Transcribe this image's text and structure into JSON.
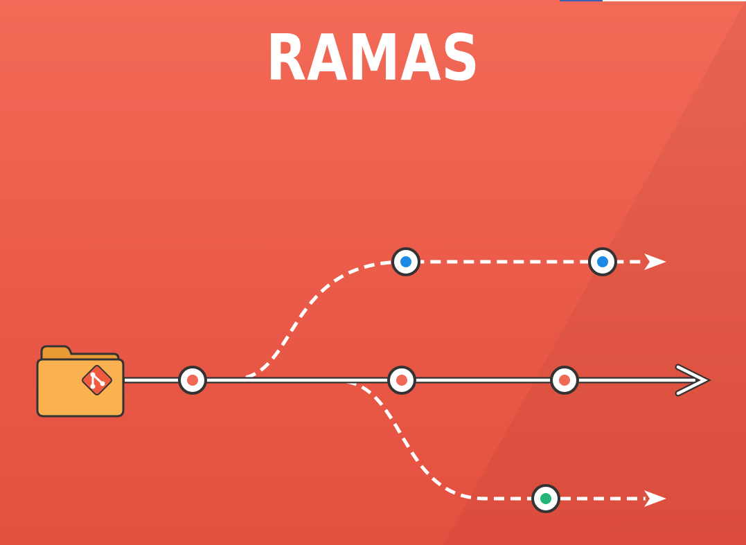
{
  "title": "RAMAS",
  "colors": {
    "background": "#ea5a48",
    "line": "#ffffff",
    "outline": "#333333",
    "main_commit": "#f06856",
    "feature_commit": "#1e88e5",
    "hotfix_commit": "#22b573",
    "folder": "#f9b24f",
    "git_badge": "#ef5b3f"
  },
  "icons": {
    "repository": "folder-icon",
    "git": "git-logo-icon"
  },
  "branches": [
    {
      "id": "main",
      "style": "solid",
      "commit_color": "main_commit",
      "commits": 3
    },
    {
      "id": "upper",
      "style": "dashed",
      "commit_color": "feature_commit",
      "commits": 2
    },
    {
      "id": "lower",
      "style": "dashed",
      "commit_color": "hotfix_commit",
      "commits": 1
    }
  ]
}
